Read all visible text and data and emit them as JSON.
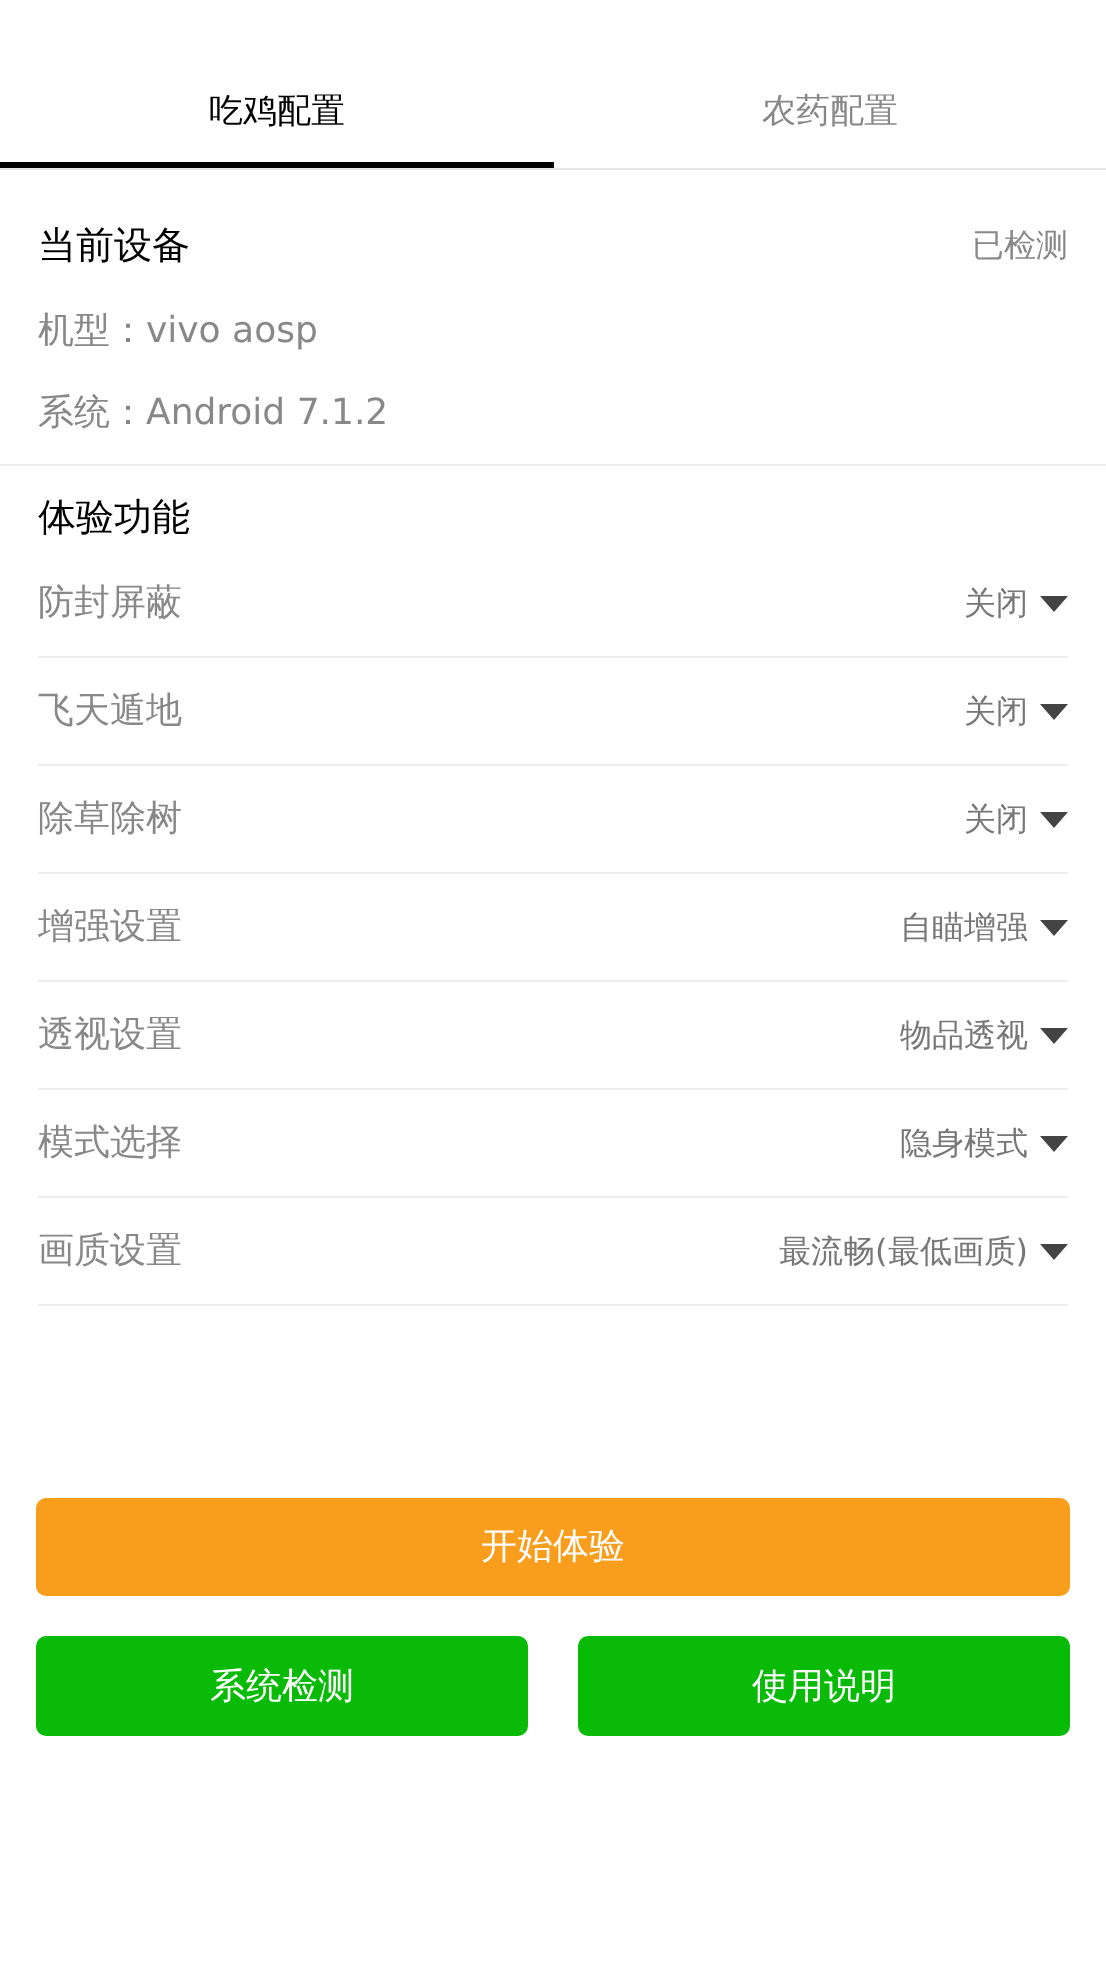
{
  "tabs": [
    {
      "label": "吃鸡配置",
      "selected": true
    },
    {
      "label": "农药配置",
      "selected": false
    }
  ],
  "device": {
    "title": "当前设备",
    "status": "已检测",
    "lines": [
      "机型：vivo aosp",
      "系统：Android 7.1.2"
    ]
  },
  "features": {
    "title": "体验功能",
    "rows": [
      {
        "label": "防封屏蔽",
        "value": "关闭"
      },
      {
        "label": "飞天遁地",
        "value": "关闭"
      },
      {
        "label": "除草除树",
        "value": "关闭"
      },
      {
        "label": "增强设置",
        "value": "自瞄增强"
      },
      {
        "label": "透视设置",
        "value": "物品透视"
      },
      {
        "label": "模式选择",
        "value": "隐身模式"
      },
      {
        "label": "画质设置",
        "value": "最流畅(最低画质)"
      }
    ]
  },
  "primary_button": "开始体验",
  "secondary_buttons": [
    "系统检测",
    "使用说明"
  ]
}
